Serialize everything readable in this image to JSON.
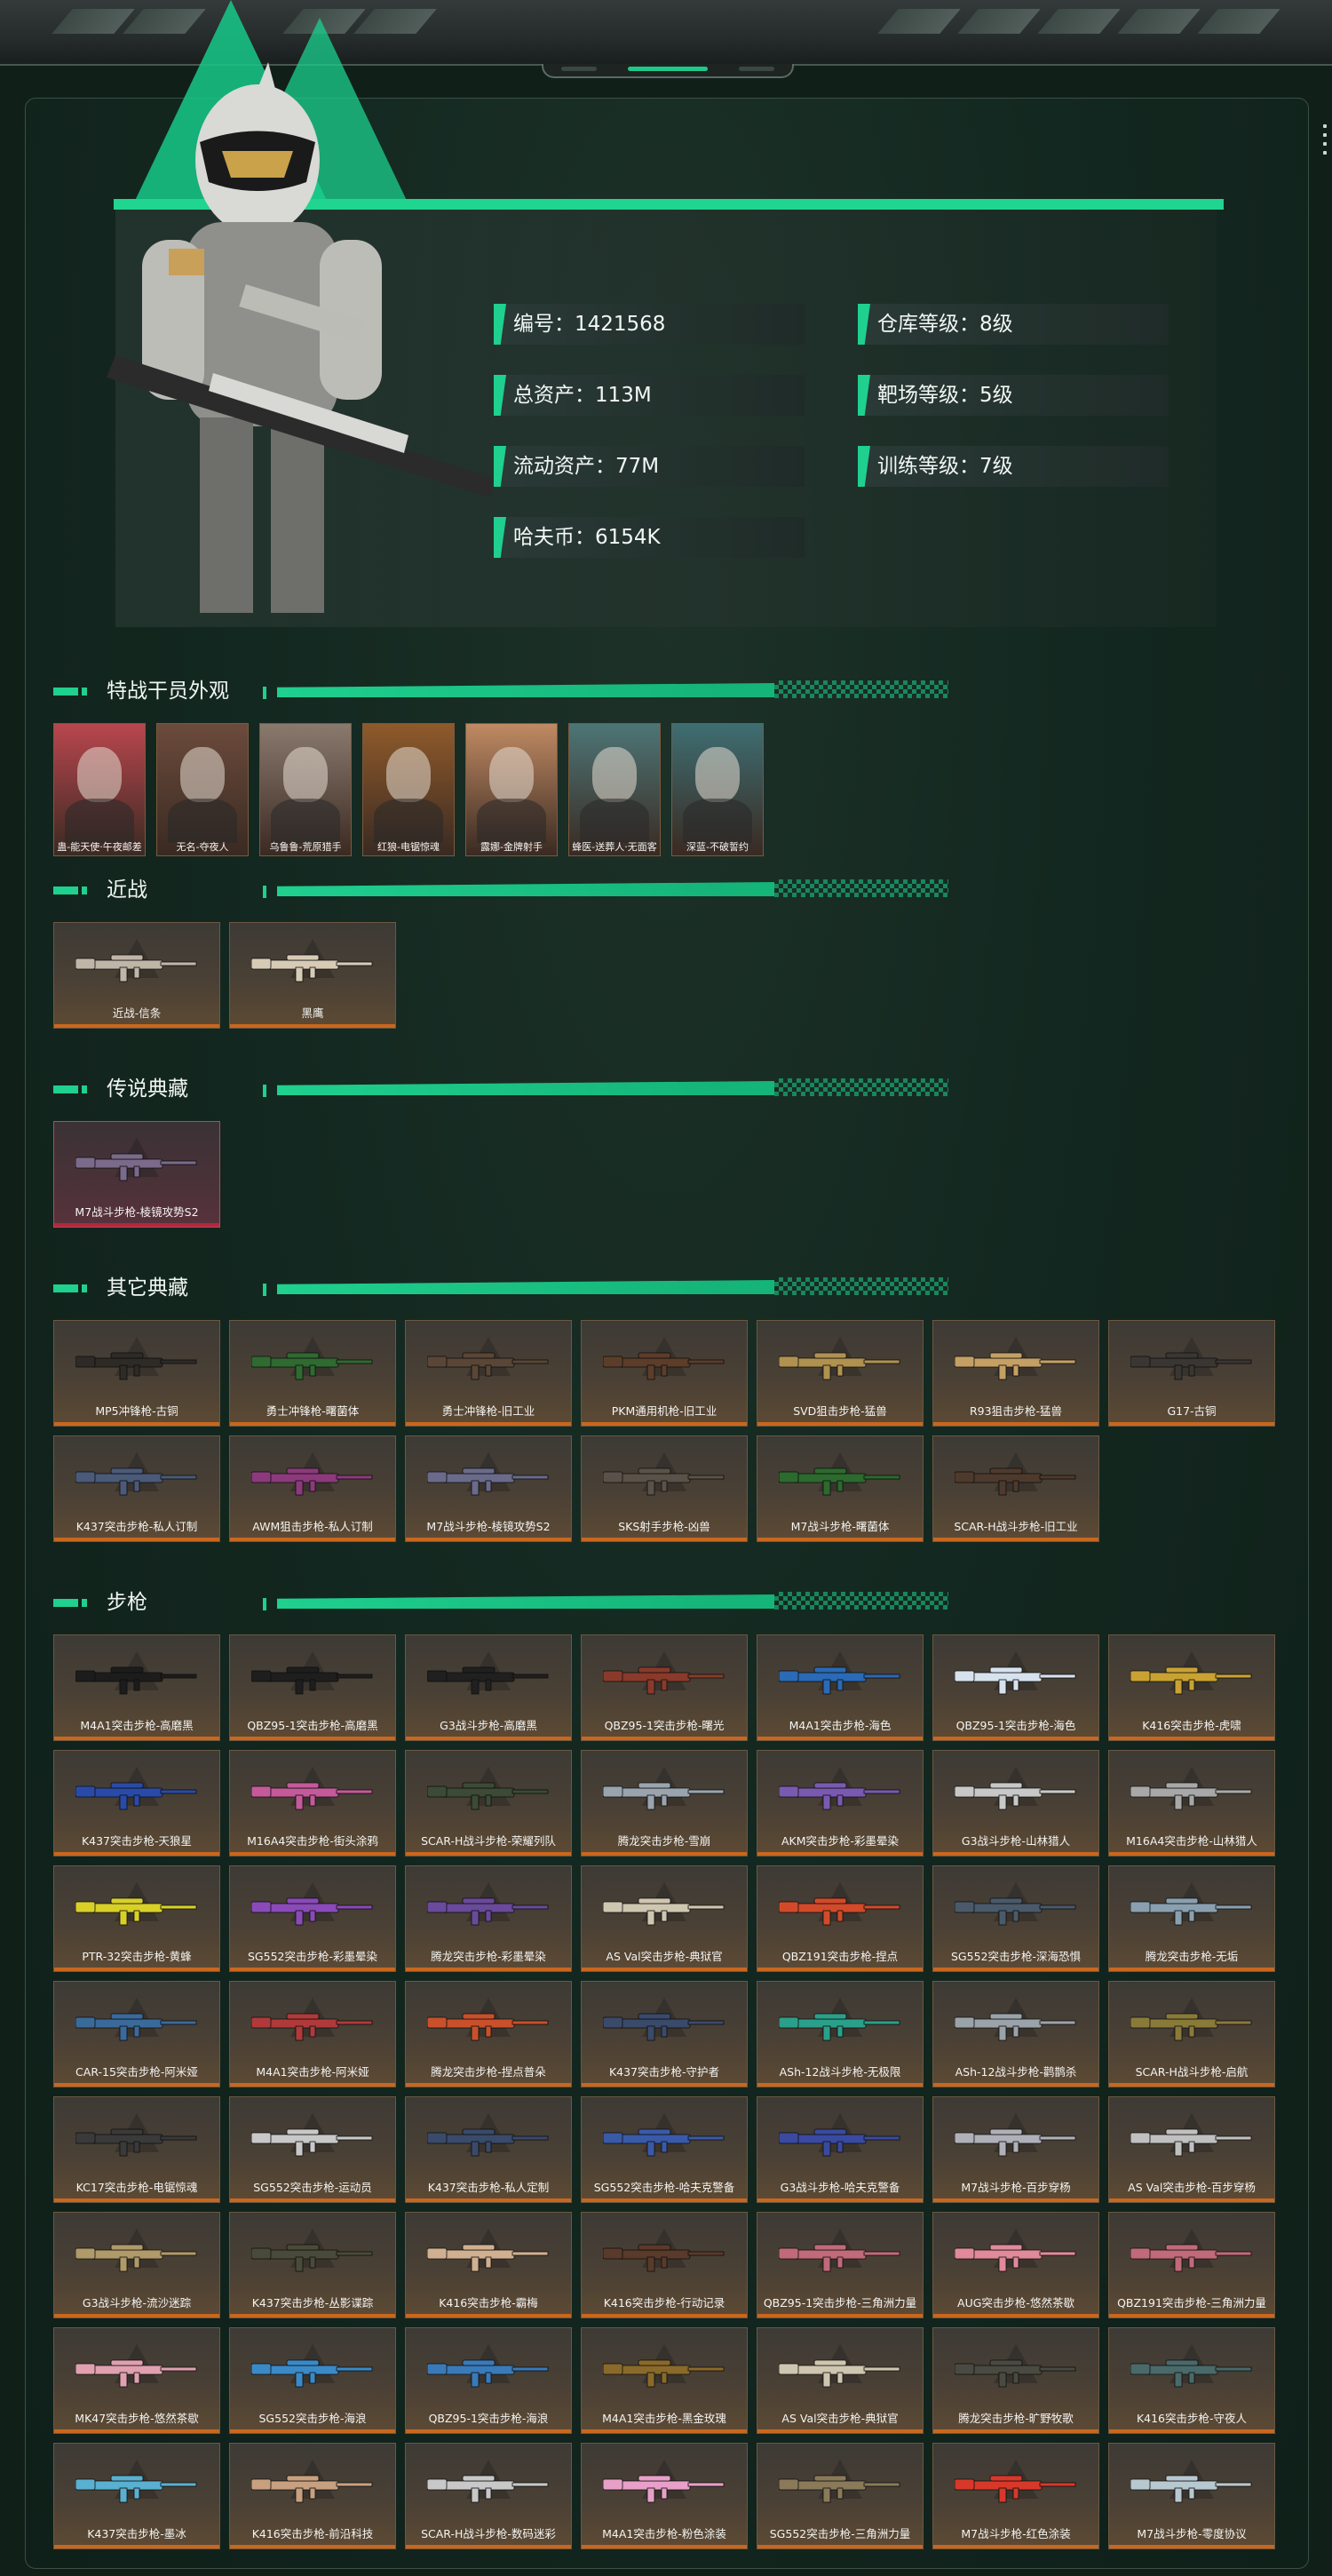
{
  "profile": {
    "stats": [
      {
        "label": "编号：1421568"
      },
      {
        "label": "仓库等级：8级"
      },
      {
        "label": "总资产：113M"
      },
      {
        "label": "靶场等级：5级"
      },
      {
        "label": "流动资产：77M"
      },
      {
        "label": "训练等级：7级"
      },
      {
        "label": "哈夫币：6154K"
      }
    ]
  },
  "sections": {
    "operators": {
      "title": "特战干员外观"
    },
    "melee": {
      "title": "近战"
    },
    "legendary": {
      "title": "传说典藏"
    },
    "other": {
      "title": "其它典藏"
    },
    "rifles": {
      "title": "步枪"
    }
  },
  "operators": [
    {
      "name": "蛊-能天使·午夜邮差",
      "color": "#b9464e"
    },
    {
      "name": "无名-夺夜人",
      "color": "#6b4b3c"
    },
    {
      "name": "乌鲁鲁-荒原猎手",
      "color": "#8a7a6e"
    },
    {
      "name": "红狼-电锯惊魂",
      "color": "#8f5a2b"
    },
    {
      "name": "露娜-金牌射手",
      "color": "#c08a63"
    },
    {
      "name": "蜂医-送葬人·无面客",
      "color": "#4d7576"
    },
    {
      "name": "深蓝-不破誓约",
      "color": "#3e6e72"
    }
  ],
  "melee": [
    {
      "name": "近战-信条",
      "color": "#bfb6a8"
    },
    {
      "name": "黑鹰",
      "color": "#d8cbb6"
    }
  ],
  "legendary": [
    {
      "name": "M7战斗步枪-棱镜攻势S2",
      "color": "#7b6a8a"
    }
  ],
  "other": [
    {
      "name": "MP5冲锋枪-古铜",
      "color": "#2e2a26"
    },
    {
      "name": "勇士冲锋枪-曙菌体",
      "color": "#2f6a30"
    },
    {
      "name": "勇士冲锋枪-旧工业",
      "color": "#5a4636"
    },
    {
      "name": "PKM通用机枪-旧工业",
      "color": "#5c3d2a"
    },
    {
      "name": "SVD狙击步枪-猛兽",
      "color": "#b09150"
    },
    {
      "name": "R93狙击步枪-猛兽",
      "color": "#c4a064"
    },
    {
      "name": "G17-古铜",
      "color": "#3a3632"
    },
    {
      "name": "K437突击步枪-私人订制",
      "color": "#4a5a78"
    },
    {
      "name": "AWM狙击步枪-私人订制",
      "color": "#8c3a7c"
    },
    {
      "name": "M7战斗步枪-棱镜攻势S2",
      "color": "#6a6a8a"
    },
    {
      "name": "SKS射手步枪-凶兽",
      "color": "#5a5248"
    },
    {
      "name": "M7战斗步枪-曙菌体",
      "color": "#2c6a2e"
    },
    {
      "name": "SCAR-H战斗步枪-旧工业",
      "color": "#4e3a2c"
    }
  ],
  "rifles": [
    {
      "name": "M4A1突击步枪-高磨黑",
      "color": "#1c1c1c"
    },
    {
      "name": "QBZ95-1突击步枪-高磨黑",
      "color": "#1e1e1e"
    },
    {
      "name": "G3战斗步枪-高磨黑",
      "color": "#202020"
    },
    {
      "name": "QBZ95-1突击步枪-曙光",
      "color": "#8a3a2a"
    },
    {
      "name": "M4A1突击步枪-海色",
      "color": "#2a6ab6"
    },
    {
      "name": "QBZ95-1突击步枪-海色",
      "color": "#d6e2ee"
    },
    {
      "name": "K416突击步枪-虎啸",
      "color": "#c9a232"
    },
    {
      "name": "K437突击步枪-天狼星",
      "color": "#2a4aa8"
    },
    {
      "name": "M16A4突击步枪-街头涂鸦",
      "color": "#c45a9a"
    },
    {
      "name": "SCAR-H战斗步枪-荣耀列队",
      "color": "#3c4a36"
    },
    {
      "name": "腾龙突击步枪-雪崩",
      "color": "#9aa4ae"
    },
    {
      "name": "AKM突击步枪-彩墨晕染",
      "color": "#7a5ab0"
    },
    {
      "name": "G3战斗步枪-山林猎人",
      "color": "#c8c8c8"
    },
    {
      "name": "M16A4突击步枪-山林猎人",
      "color": "#a8a8a8"
    },
    {
      "name": "PTR-32突击步枪-黄蜂",
      "color": "#d8d028"
    },
    {
      "name": "SG552突击步枪-彩墨晕染",
      "color": "#8a4ab8"
    },
    {
      "name": "腾龙突击步枪-彩墨晕染",
      "color": "#6a4a9a"
    },
    {
      "name": "AS Val突击步枪-典狱官",
      "color": "#cfc6b0"
    },
    {
      "name": "QBZ191突击步枪-捏点",
      "color": "#d24a2a"
    },
    {
      "name": "SG552突击步枪-深海恐惧",
      "color": "#4a5a6a"
    },
    {
      "name": "腾龙突击步枪-无垢",
      "color": "#8aa0b0"
    },
    {
      "name": "CAR-15突击步枪-阿米娅",
      "color": "#3a6a9a"
    },
    {
      "name": "M4A1突击步枪-阿米娅",
      "color": "#b03a3a"
    },
    {
      "name": "腾龙突击步枪-捏点普朵",
      "color": "#c8502a"
    },
    {
      "name": "K437突击步枪-守护者",
      "color": "#3a4a6a"
    },
    {
      "name": "ASh-12战斗步枪-无极限",
      "color": "#2aa08a"
    },
    {
      "name": "ASh-12战斗步枪-鹳鹊杀",
      "color": "#9aa2aa"
    },
    {
      "name": "SCAR-H战斗步枪-启航",
      "color": "#8a7a3a"
    },
    {
      "name": "KC17突击步枪-电锯惊魂",
      "color": "#3a3a3a"
    },
    {
      "name": "SG552突击步枪-运动员",
      "color": "#c8c8c8"
    },
    {
      "name": "K437突击步枪-私人定制",
      "color": "#3a4a6a"
    },
    {
      "name": "SG552突击步枪-哈夫克警备",
      "color": "#3a5aa8"
    },
    {
      "name": "G3战斗步枪-哈夫克警备",
      "color": "#3a4aa0"
    },
    {
      "name": "M7战斗步枪-百步穿杨",
      "color": "#b0b0b8"
    },
    {
      "name": "AS Val突击步枪-百步穿杨",
      "color": "#c0c0c0"
    },
    {
      "name": "G3战斗步枪-流沙迷踪",
      "color": "#b09a6a"
    },
    {
      "name": "K437突击步枪-丛影谍踪",
      "color": "#4a4a3a"
    },
    {
      "name": "K416突击步枪-霸梅",
      "color": "#d0b090"
    },
    {
      "name": "K416突击步枪-行动记录",
      "color": "#5a3a2a"
    },
    {
      "name": "QBZ95-1突击步枪-三角洲力量",
      "color": "#c06a7a"
    },
    {
      "name": "AUG突击步枪-悠然茶歇",
      "color": "#e08a9a"
    },
    {
      "name": "QBZ191突击步枪-三角洲力量",
      "color": "#c06a7a"
    },
    {
      "name": "MK47突击步枪-悠然茶歇",
      "color": "#e0a0b0"
    },
    {
      "name": "SG552突击步枪-海浪",
      "color": "#3a8ac8"
    },
    {
      "name": "QBZ95-1突击步枪-海浪",
      "color": "#3a7ab8"
    },
    {
      "name": "M4A1突击步枪-黑金玫瑰",
      "color": "#8a6a2a"
    },
    {
      "name": "AS Val突击步枪-典狱官",
      "color": "#cfc6b0"
    },
    {
      "name": "腾龙突击步枪-旷野牧歌",
      "color": "#4a4a42"
    },
    {
      "name": "K416突击步枪-守夜人",
      "color": "#4a6a6a"
    },
    {
      "name": "K437突击步枪-墨冰",
      "color": "#5ab0d0"
    },
    {
      "name": "K416突击步枪-前沿科技",
      "color": "#c8a080"
    },
    {
      "name": "SCAR-H战斗步枪-数码迷彩",
      "color": "#c8c8c8"
    },
    {
      "name": "M4A1突击步枪-粉色涂装",
      "color": "#e8a0c8"
    },
    {
      "name": "SG552突击步枪-三角洲力量",
      "color": "#8a7a5a"
    },
    {
      "name": "M7战斗步枪-红色涂装",
      "color": "#d8382a"
    },
    {
      "name": "M7战斗步枪-零度协议",
      "color": "#b8c8d0"
    }
  ]
}
